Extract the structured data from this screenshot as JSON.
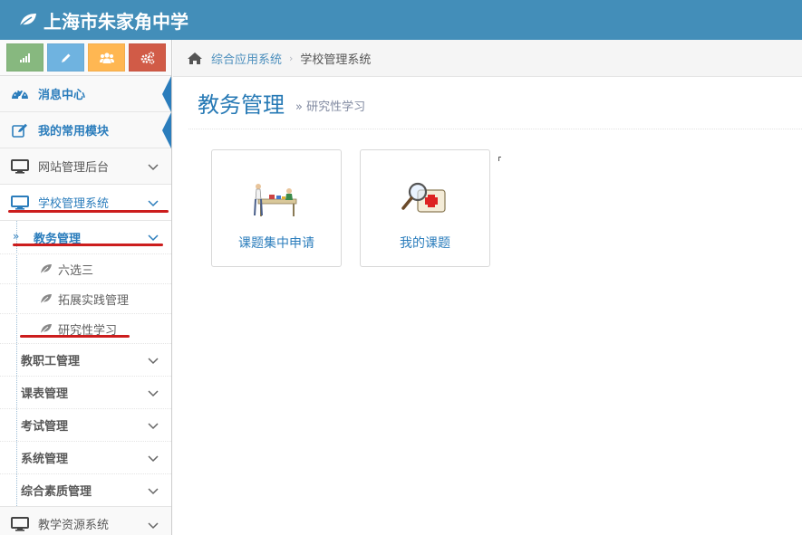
{
  "app": {
    "title": "上海市朱家角中学"
  },
  "shortcuts": [
    {
      "icon": "signal-icon",
      "color": "#87b87f"
    },
    {
      "icon": "pencil-icon",
      "color": "#6fb3e0"
    },
    {
      "icon": "users-icon",
      "color": "#ffb752"
    },
    {
      "icon": "cogs-icon",
      "color": "#d15b47"
    }
  ],
  "sidebar": {
    "items": [
      {
        "label": "消息中心",
        "icon": "dashboard-icon"
      },
      {
        "label": "我的常用模块",
        "icon": "edit-icon"
      },
      {
        "label": "网站管理后台",
        "icon": "desktop-icon"
      },
      {
        "label": "学校管理系统",
        "icon": "desktop-icon"
      }
    ],
    "school_submenu": [
      {
        "label": "教务管理",
        "marker": "»"
      },
      {
        "label": "教职工管理"
      },
      {
        "label": "课表管理"
      },
      {
        "label": "考试管理"
      },
      {
        "label": "系统管理"
      },
      {
        "label": "综合素质管理"
      }
    ],
    "academic_leaves": [
      {
        "label": "六选三"
      },
      {
        "label": "拓展实践管理"
      },
      {
        "label": "研究性学习"
      }
    ],
    "bottom_item": {
      "label": "教学资源系统",
      "icon": "desktop-icon"
    }
  },
  "breadcrumbs": {
    "home_icon": "home-icon",
    "items": [
      "综合应用系统",
      "学校管理系统"
    ],
    "separator": "›"
  },
  "page": {
    "title": "教务管理",
    "subtitle": "» 研究性学习"
  },
  "cards": [
    {
      "label": "课题集中申请",
      "icon": "workbench-illustration-icon"
    },
    {
      "label": "我的课题",
      "icon": "medical-kit-magnifier-icon"
    }
  ],
  "colors": {
    "navbar": "#438eb9",
    "link": "#2b7dbc",
    "annotation_red": "#cc1d1d"
  }
}
